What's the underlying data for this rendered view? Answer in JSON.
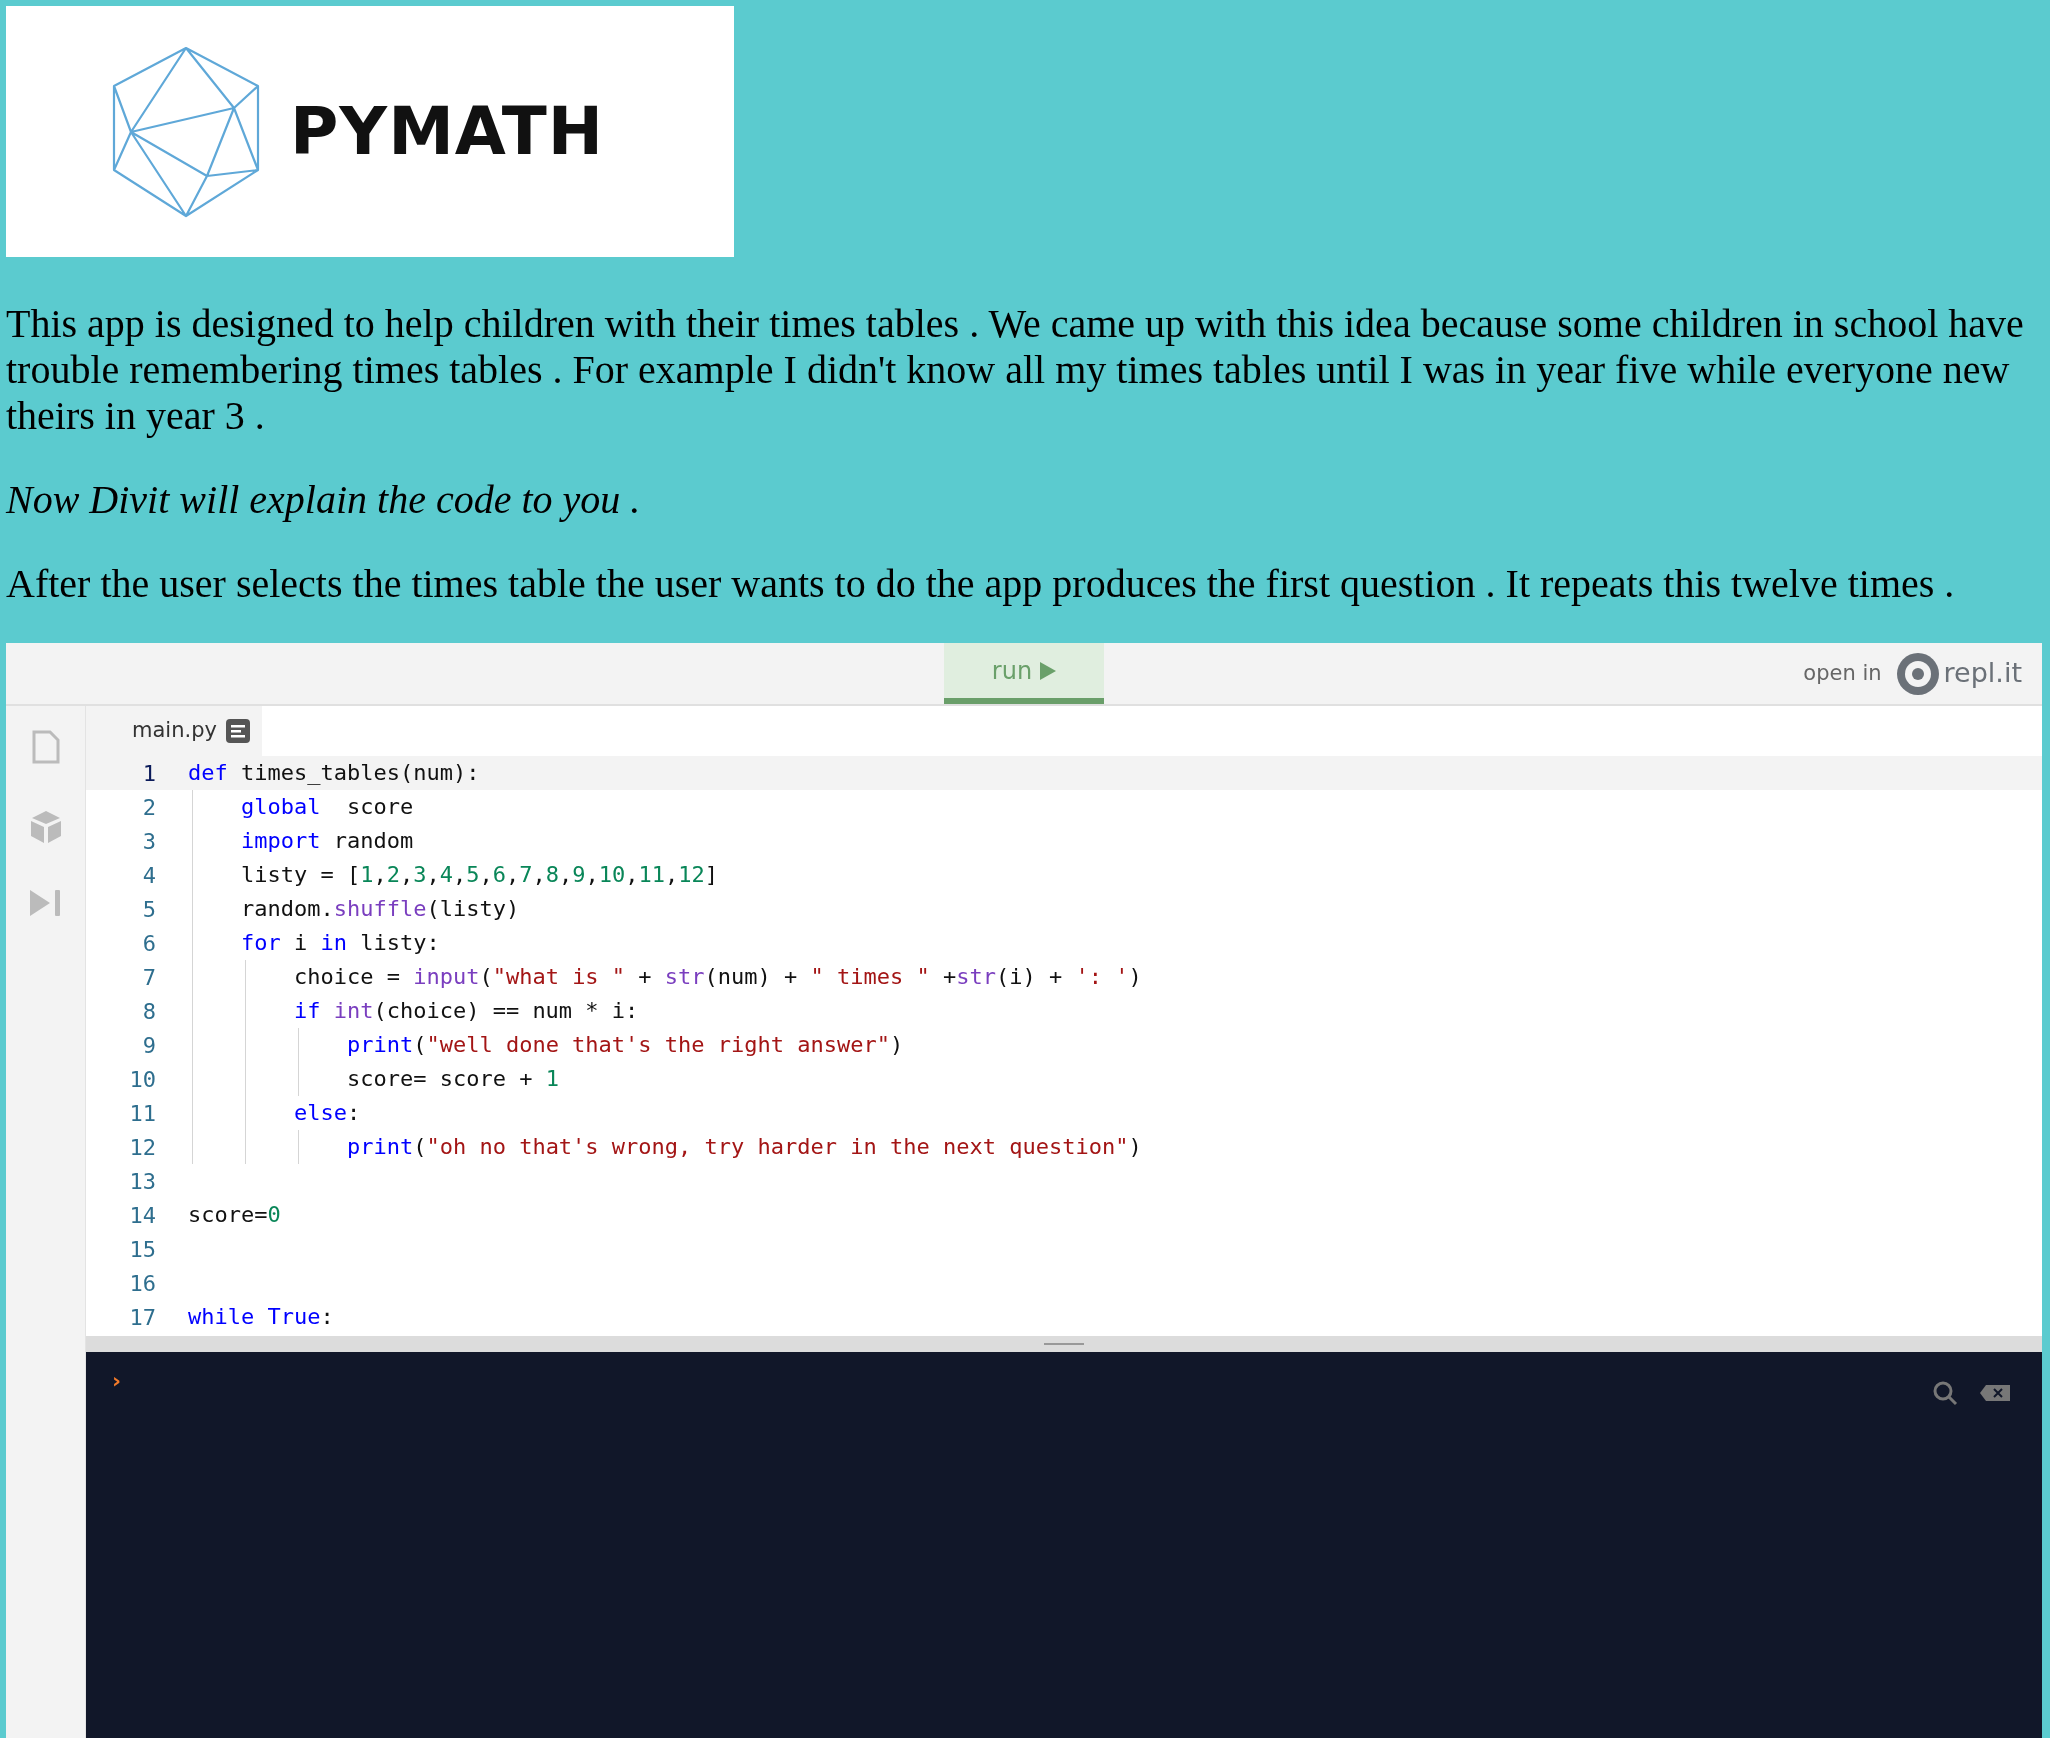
{
  "logo": {
    "text": "PYMATH"
  },
  "paragraphs": [
    {
      "text": "This app is designed to help children with their times tables . We came up with this idea because some children in school have trouble remembering times tables . For example I didn't know all my times tables until I was in year five while everyone new theirs in year 3 .",
      "italic": false
    },
    {
      "text": "Now Divit will explain the code to you .",
      "italic": true
    },
    {
      "text": "After the user selects the times table the user wants to do the app produces the first question . It repeats this twelve times .",
      "italic": false
    }
  ],
  "repl": {
    "run_button": {
      "label": "run",
      "selected": true
    },
    "open_in": "open in",
    "brand": "repl.it",
    "file_tab": "main.py",
    "lines": [
      {
        "number": "1",
        "selected": true,
        "tokens": [
          {
            "kind": "kw",
            "text": "def"
          },
          {
            "kind": "p",
            "text": " times_tables(num):"
          }
        ]
      },
      {
        "number": "2",
        "selected": false,
        "tokens": [
          {
            "kind": "kw",
            "text": "    global"
          },
          {
            "kind": "p",
            "text": "  score"
          }
        ]
      },
      {
        "number": "3",
        "selected": false,
        "tokens": [
          {
            "kind": "kw",
            "text": "    import"
          },
          {
            "kind": "p",
            "text": " random"
          }
        ]
      },
      {
        "number": "4",
        "selected": false,
        "tokens": [
          {
            "kind": "p",
            "text": "    listy = ["
          },
          {
            "kind": "num",
            "text": "1"
          },
          {
            "kind": "p",
            "text": ","
          },
          {
            "kind": "num",
            "text": "2"
          },
          {
            "kind": "p",
            "text": ","
          },
          {
            "kind": "num",
            "text": "3"
          },
          {
            "kind": "p",
            "text": ","
          },
          {
            "kind": "num",
            "text": "4"
          },
          {
            "kind": "p",
            "text": ","
          },
          {
            "kind": "num",
            "text": "5"
          },
          {
            "kind": "p",
            "text": ","
          },
          {
            "kind": "num",
            "text": "6"
          },
          {
            "kind": "p",
            "text": ","
          },
          {
            "kind": "num",
            "text": "7"
          },
          {
            "kind": "p",
            "text": ","
          },
          {
            "kind": "num",
            "text": "8"
          },
          {
            "kind": "p",
            "text": ","
          },
          {
            "kind": "num",
            "text": "9"
          },
          {
            "kind": "p",
            "text": ","
          },
          {
            "kind": "num",
            "text": "10"
          },
          {
            "kind": "p",
            "text": ","
          },
          {
            "kind": "num",
            "text": "11"
          },
          {
            "kind": "p",
            "text": ","
          },
          {
            "kind": "num",
            "text": "12"
          },
          {
            "kind": "p",
            "text": "]"
          }
        ]
      },
      {
        "number": "5",
        "selected": false,
        "tokens": [
          {
            "kind": "p",
            "text": "    random."
          },
          {
            "kind": "fn",
            "text": "shuffle"
          },
          {
            "kind": "p",
            "text": "(listy)"
          }
        ]
      },
      {
        "number": "6",
        "selected": false,
        "tokens": [
          {
            "kind": "kw",
            "text": "    for"
          },
          {
            "kind": "p",
            "text": " i "
          },
          {
            "kind": "kw",
            "text": "in"
          },
          {
            "kind": "p",
            "text": " listy:"
          }
        ]
      },
      {
        "number": "7",
        "selected": false,
        "tokens": [
          {
            "kind": "p",
            "text": "        choice = "
          },
          {
            "kind": "fn",
            "text": "input"
          },
          {
            "kind": "p",
            "text": "("
          },
          {
            "kind": "str",
            "text": "\"what is \""
          },
          {
            "kind": "p",
            "text": " + "
          },
          {
            "kind": "fn",
            "text": "str"
          },
          {
            "kind": "p",
            "text": "(num) + "
          },
          {
            "kind": "str",
            "text": "\" times \""
          },
          {
            "kind": "p",
            "text": " +"
          },
          {
            "kind": "fn",
            "text": "str"
          },
          {
            "kind": "p",
            "text": "(i) + "
          },
          {
            "kind": "str",
            "text": "': '"
          },
          {
            "kind": "p",
            "text": ")"
          }
        ]
      },
      {
        "number": "8",
        "selected": false,
        "tokens": [
          {
            "kind": "kw",
            "text": "        if"
          },
          {
            "kind": "fn",
            "text": " int"
          },
          {
            "kind": "p",
            "text": "(choice) == num * i:"
          }
        ]
      },
      {
        "number": "9",
        "selected": false,
        "tokens": [
          {
            "kind": "kw",
            "text": "            print"
          },
          {
            "kind": "p",
            "text": "("
          },
          {
            "kind": "str",
            "text": "\"well done that's the right answer\""
          },
          {
            "kind": "p",
            "text": ")"
          }
        ]
      },
      {
        "number": "10",
        "selected": false,
        "tokens": [
          {
            "kind": "p",
            "text": "            score= score + "
          },
          {
            "kind": "num",
            "text": "1"
          }
        ]
      },
      {
        "number": "11",
        "selected": false,
        "tokens": [
          {
            "kind": "kw",
            "text": "        else"
          },
          {
            "kind": "p",
            "text": ":"
          }
        ]
      },
      {
        "number": "12",
        "selected": false,
        "tokens": [
          {
            "kind": "kw",
            "text": "            print"
          },
          {
            "kind": "p",
            "text": "("
          },
          {
            "kind": "str",
            "text": "\"oh no that's wrong, try harder in the next question\""
          },
          {
            "kind": "p",
            "text": ")"
          }
        ]
      },
      {
        "number": "13",
        "selected": false
      },
      {
        "number": "14",
        "selected": false,
        "tokens": [
          {
            "kind": "p",
            "text": "score="
          },
          {
            "kind": "num",
            "text": "0"
          }
        ]
      },
      {
        "number": "15",
        "selected": false
      },
      {
        "number": "16",
        "selected": false
      },
      {
        "number": "17",
        "selected": false,
        "tokens": [
          {
            "kind": "kw",
            "text": "while"
          },
          {
            "kind": "kw",
            "text": " True"
          },
          {
            "kind": "p",
            "text": ":"
          }
        ]
      }
    ],
    "console": {
      "prompt": "›"
    }
  }
}
